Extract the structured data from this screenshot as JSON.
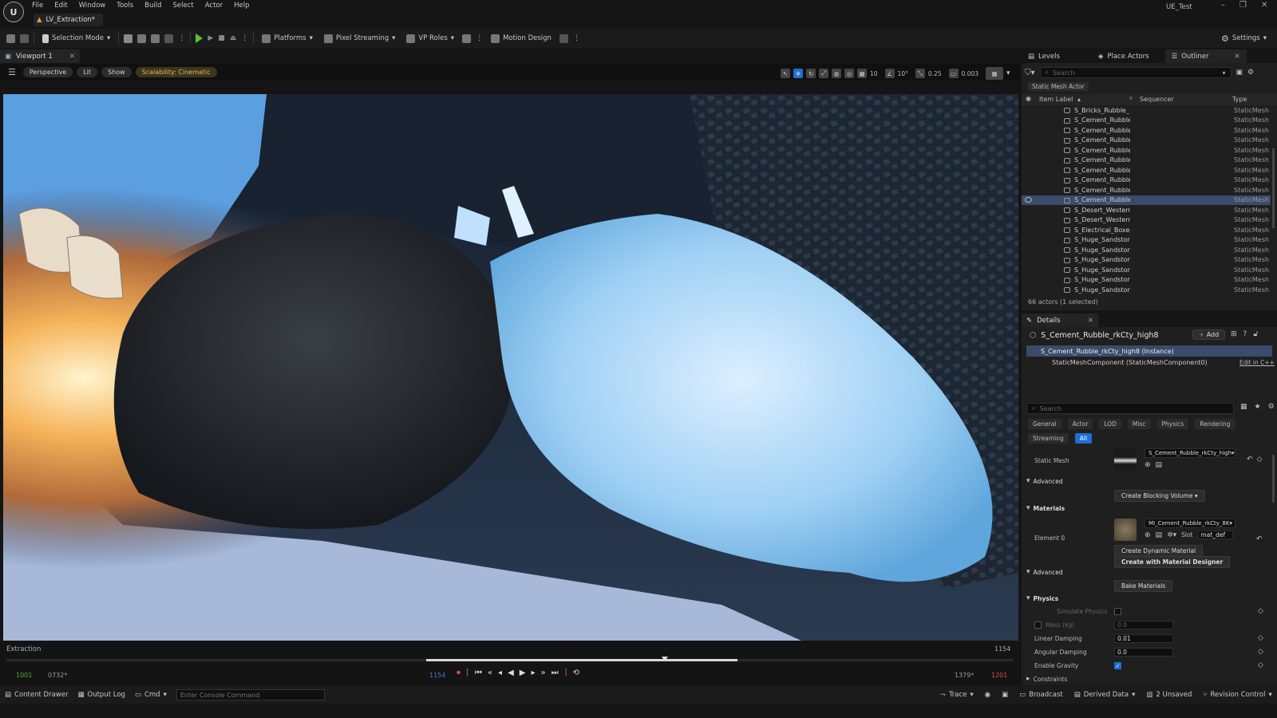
{
  "menu": [
    "File",
    "Edit",
    "Window",
    "Tools",
    "Build",
    "Select",
    "Actor",
    "Help"
  ],
  "project_name": "UE_Test",
  "level_tab": "LV_Extraction*",
  "toolbar": {
    "selection_mode": "Selection Mode",
    "platforms": "Platforms",
    "pixel_streaming": "Pixel Streaming",
    "vp_roles": "VP Roles",
    "motion_design": "Motion Design",
    "settings": "Settings"
  },
  "viewport": {
    "tab": "Viewport 1",
    "perspective": "Perspective",
    "lit": "Lit",
    "show": "Show",
    "scalability": "Scalability: Cinematic",
    "grid_size": "10",
    "angle": "10°",
    "scale": "0.25",
    "camera_speed": "0.003"
  },
  "sequencer": {
    "name": "Extraction",
    "frame_right": "1154",
    "start": "1001",
    "current": "0732*",
    "in": "1154",
    "out": "1379*",
    "end": "1201"
  },
  "statusbar": {
    "content_drawer": "Content Drawer",
    "output_log": "Output Log",
    "cmd": "Cmd",
    "console_placeholder": "Enter Console Command",
    "trace": "Trace",
    "broadcast": "Broadcast",
    "derived_data": "Derived Data",
    "unsaved": "2 Unsaved",
    "revision_control": "Revision Control"
  },
  "right_tabs": {
    "levels": "Levels",
    "place_actors": "Place Actors",
    "outliner": "Outliner"
  },
  "outliner": {
    "search_placeholder": "Search",
    "filter_chip": "Static Mesh Actor",
    "col_label": "Item Label",
    "col_sequencer": "Sequencer",
    "col_type": "Type",
    "items": [
      {
        "label": "S_Bricks_Rubble_",
        "type": "StaticMesh",
        "selected": false
      },
      {
        "label": "S_Cement_Rubble_",
        "type": "StaticMesh",
        "selected": false
      },
      {
        "label": "S_Cement_Rubble_",
        "type": "StaticMesh",
        "selected": false
      },
      {
        "label": "S_Cement_Rubble_",
        "type": "StaticMesh",
        "selected": false
      },
      {
        "label": "S_Cement_Rubble_",
        "type": "StaticMesh",
        "selected": false
      },
      {
        "label": "S_Cement_Rubble_",
        "type": "StaticMesh",
        "selected": false
      },
      {
        "label": "S_Cement_Rubble_",
        "type": "StaticMesh",
        "selected": false
      },
      {
        "label": "S_Cement_Rubble_",
        "type": "StaticMesh",
        "selected": false
      },
      {
        "label": "S_Cement_Rubble_",
        "type": "StaticMesh",
        "selected": false
      },
      {
        "label": "S_Cement_Rubble_",
        "type": "StaticMesh",
        "selected": true
      },
      {
        "label": "S_Desert_Western",
        "type": "StaticMesh",
        "selected": false
      },
      {
        "label": "S_Desert_Western",
        "type": "StaticMesh",
        "selected": false
      },
      {
        "label": "S_Electrical_Boxes",
        "type": "StaticMesh",
        "selected": false
      },
      {
        "label": "S_Huge_Sandstone",
        "type": "StaticMesh",
        "selected": false
      },
      {
        "label": "S_Huge_Sandstone",
        "type": "StaticMesh",
        "selected": false
      },
      {
        "label": "S_Huge_Sandstone",
        "type": "StaticMesh",
        "selected": false
      },
      {
        "label": "S_Huge_Sandstone",
        "type": "StaticMesh",
        "selected": false
      },
      {
        "label": "S_Huge_Sandstone",
        "type": "StaticMesh",
        "selected": false
      },
      {
        "label": "S_Huge_Sandstone",
        "type": "StaticMesh",
        "selected": false
      }
    ],
    "count": "66 actors (1 selected)"
  },
  "details": {
    "tab": "Details",
    "title": "S_Cement_Rubble_rkCty_high8",
    "add": "Add",
    "instance": "S_Cement_Rubble_rkCty_high8 (Instance)",
    "component": "StaticMeshComponent (StaticMeshComponent0)",
    "edit_cpp": "Edit in C++",
    "search_placeholder": "Search",
    "categories": [
      "General",
      "Actor",
      "LOD",
      "Misc",
      "Physics",
      "Rendering",
      "Streaming",
      "All"
    ],
    "active_category": "All",
    "static_mesh_label": "Static Mesh",
    "static_mesh_value": "S_Cement_Rubble_rkCty_high",
    "advanced": "Advanced",
    "create_blocking_volume": "Create Blocking Volume",
    "materials": "Materials",
    "element0": "Element 0",
    "material_value": "MI_Cement_Rubble_rkCty_8K",
    "slot_label": "Slot",
    "slot_value": "mat_def",
    "create_dynamic_material": "Create Dynamic Material",
    "create_with_designer": "Create with Material Designer",
    "advanced2": "Advanced",
    "bake_materials": "Bake Materials",
    "physics": "Physics",
    "simulate_physics": "Simulate Physics",
    "mass": "Mass (kg)",
    "mass_value": "0.0",
    "linear_damping": "Linear Damping",
    "linear_damping_value": "0.01",
    "angular_damping": "Angular Damping",
    "angular_damping_value": "0.0",
    "enable_gravity": "Enable Gravity",
    "constraints": "Constraints"
  },
  "colors": {
    "accent": "#1f6fd1",
    "play_green": "#5fbf3a",
    "record_red": "#d94a4a",
    "selection": "#3a4b6b"
  }
}
